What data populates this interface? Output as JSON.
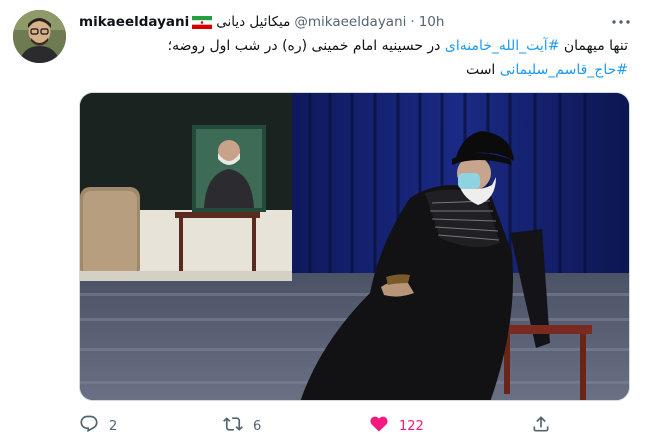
{
  "tweet": {
    "author": {
      "display_name": "mikaeeldayani",
      "display_name_fa": "میکائیل دیانی",
      "flag_icon": "iran-flag",
      "handle": "@mikaeeldayani",
      "separator": "·",
      "time": "10h"
    },
    "text": {
      "line1_prefix": "تنها میهمان ",
      "hashtag1": "#آیت_الله_خامنه‌ای",
      "line1_suffix": " در حسینیه امام خمینی (ره) در شب اول روضه؛",
      "hashtag2": "#حاج_قاسم_سلیمانی",
      "line2_suffix": " است"
    },
    "actions": {
      "reply_count": "2",
      "retweet_count": "6",
      "like_count": "122"
    },
    "colors": {
      "link": "#1d9bf0",
      "secondary": "#536471",
      "like": "#f91880"
    }
  }
}
